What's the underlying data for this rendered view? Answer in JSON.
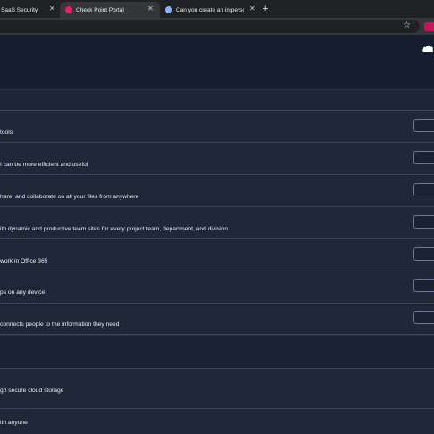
{
  "browser": {
    "tabs": [
      {
        "title": "SaaS Security",
        "active": false
      },
      {
        "title": "Check Point Portal",
        "active": true,
        "favicon_color": "#e91e63"
      },
      {
        "title": "Can you create an impersonati",
        "active": false,
        "favicon_color": "#8ab4f8"
      }
    ],
    "new_tab_label": "+"
  },
  "section_one": {
    "items": [
      {
        "description": "tools"
      },
      {
        "description": "I can be more efficient and useful"
      },
      {
        "description": "hare, and collaborate on all your files from anywhere"
      },
      {
        "description": "ith dynamic and productive team sites for every project team, department, and division"
      },
      {
        "description": "work in Office 365"
      },
      {
        "description": "ps on any device"
      },
      {
        "description": "connects people to the information they need"
      }
    ]
  },
  "section_two": {
    "items": [
      {
        "description": "gh secure cloud storage"
      },
      {
        "description": "ith anyone"
      }
    ]
  },
  "colors": {
    "background": "#1b2233",
    "header": "#161d2e",
    "row": "#1f2738",
    "button_border": "#6b7a99"
  }
}
